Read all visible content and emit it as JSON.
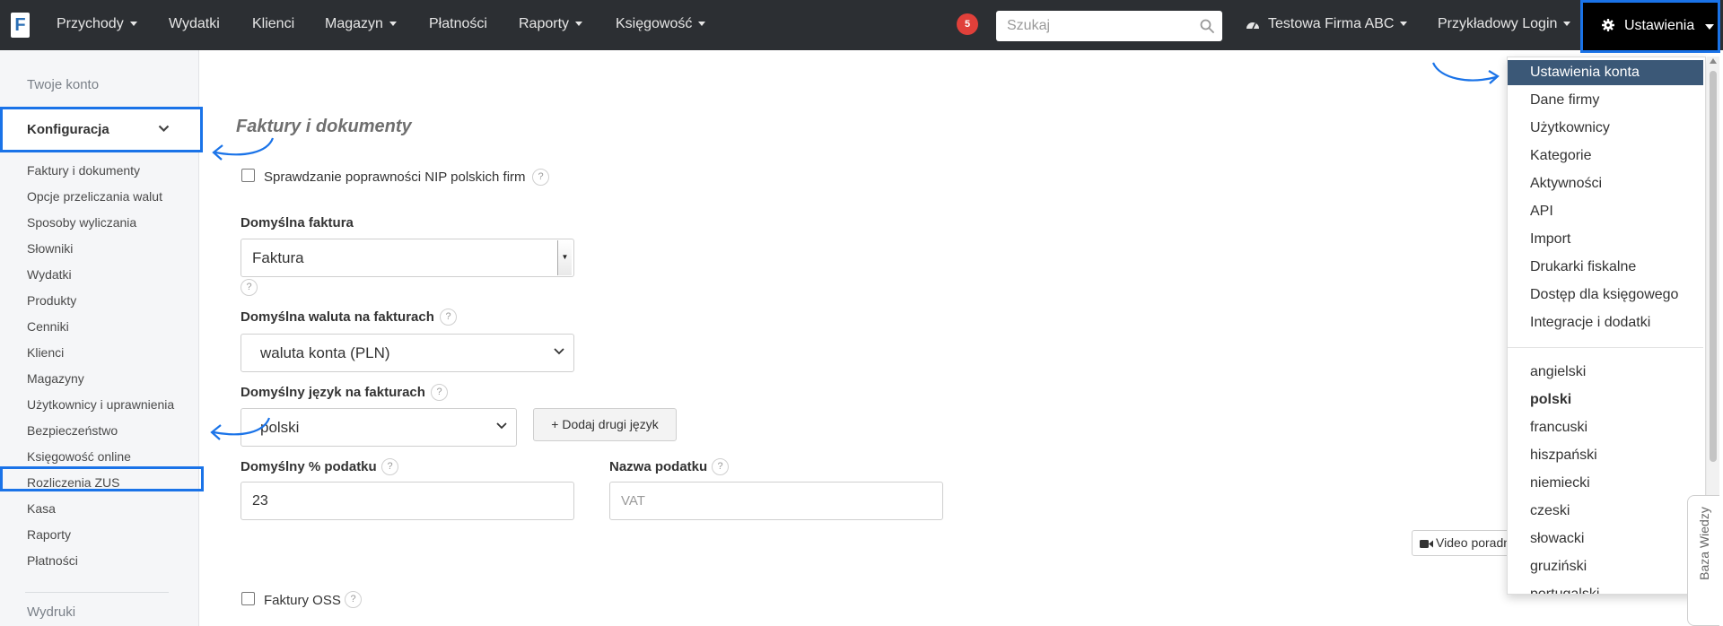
{
  "navbar": {
    "logo_letter": "F",
    "items": [
      {
        "label": "Przychody",
        "dropdown": true
      },
      {
        "label": "Wydatki",
        "dropdown": false
      },
      {
        "label": "Klienci",
        "dropdown": false
      },
      {
        "label": "Magazyn",
        "dropdown": true
      },
      {
        "label": "Płatności",
        "dropdown": false
      },
      {
        "label": "Raporty",
        "dropdown": true
      },
      {
        "label": "Księgowość",
        "dropdown": true
      }
    ],
    "notification_count": "5",
    "search_placeholder": "Szukaj",
    "company_label": "Testowa Firma ABC",
    "user_label": "Przykładowy Login",
    "settings_label": "Ustawienia",
    "accent_color": "#1a73e8"
  },
  "sidebar": {
    "account_link": "Twoje konto",
    "section_title": "Konfiguracja",
    "items": [
      "Faktury i dokumenty",
      "Opcje przeliczania walut",
      "Sposoby wyliczania",
      "Słowniki",
      "Wydatki",
      "Produkty",
      "Cenniki",
      "Klienci",
      "Magazyny",
      "Użytkownicy i uprawnienia",
      "Bezpieczeństwo",
      "Księgowość online",
      "Rozliczenia ZUS",
      "Kasa",
      "Raporty",
      "Płatności"
    ],
    "highlighted_item": "Bezpieczeństwo",
    "footer_section": "Wydruki"
  },
  "main": {
    "title": "Faktury i dokumenty",
    "nip_check_label": "Sprawdzanie poprawności NIP polskich firm",
    "nip_check_checked": false,
    "default_invoice_label": "Domyślna faktura",
    "default_invoice_value": "Faktura",
    "default_currency_label": "Domyślna waluta na fakturach",
    "default_currency_value": "waluta konta (PLN)",
    "default_language_label": "Domyślny język na fakturach",
    "default_language_value": "polski",
    "add_language_button": "+ Dodaj drugi język",
    "default_tax_label": "Domyślny % podatku",
    "default_tax_value": "23",
    "tax_name_label": "Nazwa podatku",
    "tax_name_placeholder": "VAT",
    "video_button": "Video poradnik",
    "oss_label": "Faktury OSS",
    "oss_checked": false,
    "help_glyph": "?"
  },
  "settings_menu": {
    "items": [
      "Ustawienia konta",
      "Dane firmy",
      "Użytkownicy",
      "Kategorie",
      "Aktywności",
      "API",
      "Import",
      "Drukarki fiskalne",
      "Dostęp dla księgowego",
      "Integracje i dodatki"
    ],
    "active_item": "Ustawienia konta",
    "languages": [
      "angielski",
      "polski",
      "francuski",
      "hiszpański",
      "niemiecki",
      "czeski",
      "słowacki",
      "gruziński",
      "portugalski"
    ],
    "selected_language": "polski",
    "active_color": "#3b5877"
  },
  "knowledge_base_tab": "Baza Wiedzy"
}
